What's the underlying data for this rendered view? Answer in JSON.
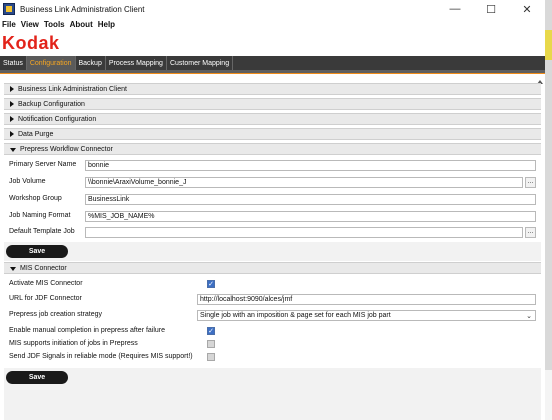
{
  "window": {
    "title": "Business Link Administration Client",
    "minimize_glyph": "—",
    "maximize_glyph": "☐",
    "close_glyph": "✕"
  },
  "menubar": {
    "items": [
      "File",
      "View",
      "Tools",
      "About",
      "Help"
    ]
  },
  "brand": {
    "logo_text": "Kodak",
    "logo_color": "#e2231a",
    "accent_color": "#f5a623"
  },
  "tabs": [
    {
      "label": "Status",
      "active": false
    },
    {
      "label": "Configuration",
      "active": true
    },
    {
      "label": "Backup",
      "active": false
    },
    {
      "label": "Process Mapping",
      "active": false
    },
    {
      "label": "Customer Mapping",
      "active": false
    }
  ],
  "sections": {
    "business_link": {
      "label": "Business Link Administration Client",
      "expanded": false
    },
    "backup": {
      "label": "Backup Configuration",
      "expanded": false
    },
    "notification": {
      "label": "Notification Configuration",
      "expanded": false
    },
    "data_purge": {
      "label": "Data Purge",
      "expanded": false
    },
    "prepress": {
      "label": "Prepress Workflow Connector",
      "expanded": true
    },
    "mis": {
      "label": "MIS Connector",
      "expanded": true
    }
  },
  "prepress": {
    "primary_server": {
      "label": "Primary Server Name",
      "value": "bonnie"
    },
    "job_volume": {
      "label": "Job Volume",
      "value": "\\\\bonnie\\AraxiVolume_bonnie_J",
      "browse": "..."
    },
    "workshop_group": {
      "label": "Workshop Group",
      "value": "BusinessLink"
    },
    "job_naming": {
      "label": "Job Naming Format",
      "value": "%MIS_JOB_NAME%"
    },
    "default_template": {
      "label": "Default Template Job",
      "value": "",
      "browse": "..."
    },
    "save_label": "Save"
  },
  "mis": {
    "activate": {
      "label": "Activate MIS Connector",
      "checked": true
    },
    "url": {
      "label": "URL for JDF Connector",
      "value": "http://localhost:9090/alces/jmf"
    },
    "strategy": {
      "label": "Prepress job creation strategy",
      "value": "Single job with an imposition & page set for each MIS job part"
    },
    "manual_completion": {
      "label": "Enable manual completion in prepress after failure",
      "checked": true
    },
    "initiation": {
      "label": "MIS supports initiation of jobs in Prepress",
      "checked": false
    },
    "jdf_signals": {
      "label": "Send JDF Signals in reliable mode (Requires MIS support!)",
      "checked": false
    },
    "save_label": "Save"
  },
  "check_glyph": "✓"
}
